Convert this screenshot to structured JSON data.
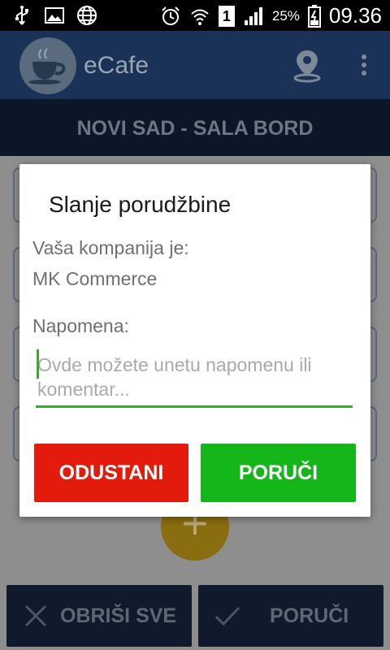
{
  "status_bar": {
    "icons": [
      "usb-icon",
      "image-icon",
      "globe-icon",
      "alarm-icon",
      "wifi-icon",
      "sim-1-icon",
      "signal-icon",
      "battery-icon"
    ],
    "sim_label": "1",
    "battery": "25%",
    "time": "09.36"
  },
  "app_bar": {
    "title": "eCafe",
    "icons": [
      "coffee-cup-logo",
      "location-pin-icon",
      "overflow-menu-icon"
    ]
  },
  "location": {
    "name": "NOVI SAD - SALA BORD"
  },
  "bottom_bar": {
    "clear_label": "OBRIŠI SVE",
    "order_label": "PORUČI"
  },
  "fab": {
    "label": "+"
  },
  "dialog": {
    "title": "Slanje porudžbine",
    "company_label": "Vaša kompanija je:",
    "company_value": "MK Commerce",
    "note_label": "Napomena:",
    "note_placeholder": "Ovde možete unetu napomenu ili komentar...",
    "note_value": "",
    "cancel_label": "ODUSTANI",
    "order_label": "PORUČI"
  },
  "colors": {
    "app_bar": "#1a3258",
    "cancel": "#e31b0c",
    "confirm": "#15b61a",
    "accent_underline": "#3aa832",
    "fab": "#f0b100"
  }
}
